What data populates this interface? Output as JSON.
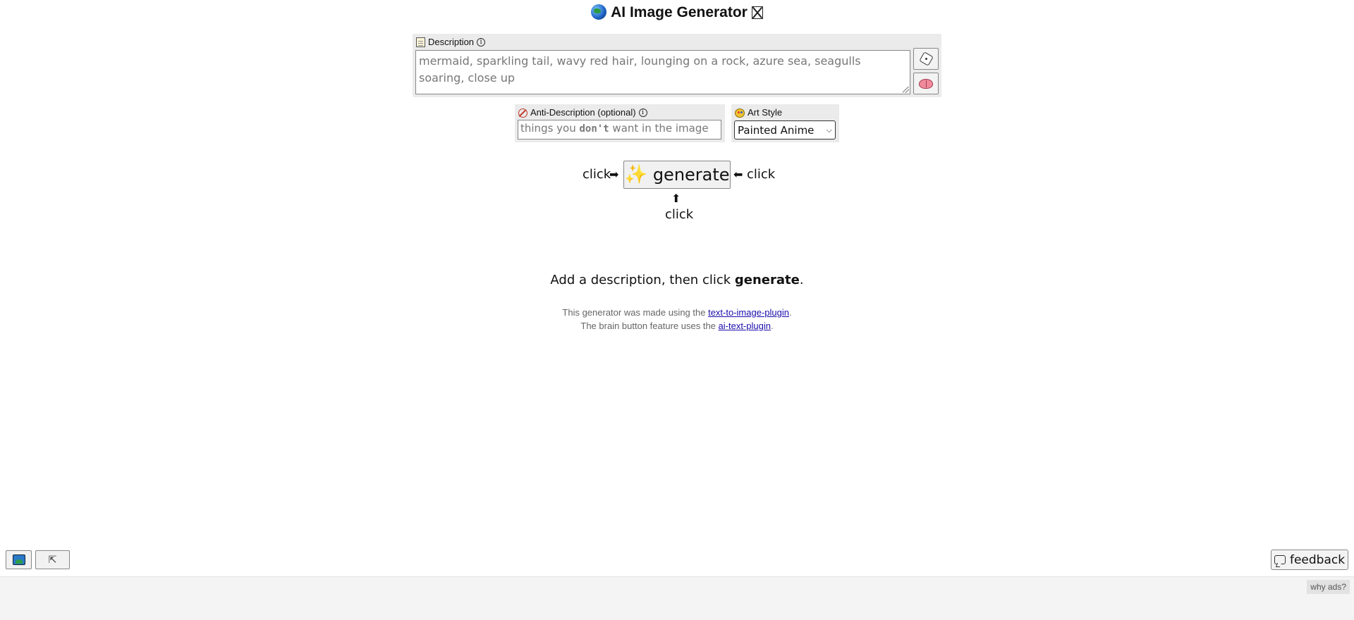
{
  "header": {
    "title": "AI Image Generator",
    "globe_icon": "globe-icon",
    "trailing_icon": "x-box-icon"
  },
  "description": {
    "label": "Description",
    "value": "mermaid, sparkling tail, wavy red hair, lounging on a rock, azure sea, seagulls soaring, close up",
    "random_button_icon": "dice-icon",
    "brain_button_icon": "brain-icon"
  },
  "anti_description": {
    "label": "Anti-Description (optional)",
    "placeholder_prefix": "things you ",
    "placeholder_bold": "don't",
    "placeholder_suffix": " want in the image"
  },
  "art_style": {
    "label": "Art Style",
    "selected": "Painted Anime"
  },
  "generate": {
    "label": "generate",
    "click_left": "click",
    "click_right": "click",
    "click_below": "click",
    "arrow_left": "➡",
    "arrow_right": "⬅",
    "arrow_up": "⬆"
  },
  "hint": {
    "prefix": "Add a description, then click ",
    "bold": "generate",
    "suffix": "."
  },
  "credits": {
    "line1_prefix": "This generator was made using the ",
    "line1_link": "text-to-image-plugin",
    "line1_suffix": ".",
    "line2_prefix": "The brain button feature uses the ",
    "line2_link": "ai-text-plugin",
    "line2_suffix": "."
  },
  "footer": {
    "feedback_label": "feedback",
    "why_ads": "why ads?",
    "expand_icon": "⇱"
  }
}
